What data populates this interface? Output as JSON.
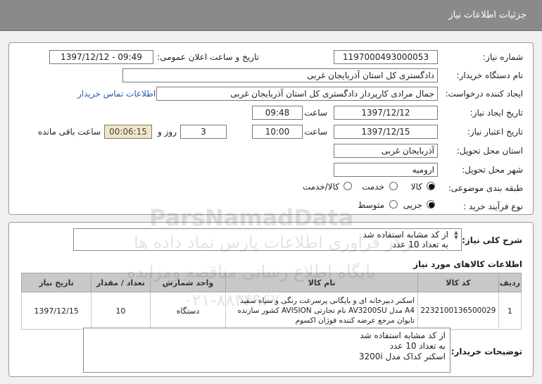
{
  "header": {
    "title": "جزئیات اطلاعات نیاز"
  },
  "form": {
    "need_number_label": "شماره نیاز:",
    "need_number": "1197000493000053",
    "announce_label": "تاریخ و ساعت اعلان عمومی:",
    "announce_value": "1397/12/12 - 09:49",
    "buyer_org_label": "نام دستگاه خریدار:",
    "buyer_org": "دادگستری کل استان آذربایجان غربی",
    "requester_label": "ایجاد کننده درخواست:",
    "requester": "جمال مرادی کارپرداز دادگستری کل استان آذربایجان غربی",
    "contact_link": "اطلاعات تماس خریدار",
    "create_date_label": "تاریخ ایجاد نیاز:",
    "create_date": "1397/12/12",
    "time_label": "ساعت",
    "create_time": "09:48",
    "valid_date_label": "تاریخ اعتبار نیاز:",
    "valid_date": "1397/12/15",
    "valid_time": "10:00",
    "days": "3",
    "days_label": "روز و",
    "remaining": "00:06:15",
    "remaining_label": "ساعت باقی مانده",
    "province_label": "استان محل تحویل:",
    "province": "آذربایجان غربی",
    "city_label": "شهر محل تحویل:",
    "city": "ارومیه",
    "category_label": "طبقه بندی موضوعی:",
    "category_options": [
      "کالا",
      "خدمت",
      "کالا/خدمت"
    ],
    "category_selected": 0,
    "process_label": "نوع فرآیند خرید :",
    "process_options": [
      "جزیی",
      "متوسط"
    ],
    "process_selected": 0
  },
  "summary": {
    "label": "شرح کلی نیاز:",
    "line1": "از کد مشابه استفاده شد",
    "line2": "به تعداد 10 عدد"
  },
  "goods": {
    "title": "اطلاعات کالاهای مورد نیاز",
    "columns": [
      "ردیف",
      "کد کالا",
      "نام کالا",
      "واحد شمارش",
      "تعداد / مقدار",
      "تاریخ نیاز"
    ],
    "rows": [
      {
        "row": "1",
        "code": "2232100136500029",
        "name": "اسکنر دبیرخانه ای و بایگانی پرسرعت رنگی و سیاه سفید A4 مدل AV3200SU نام تجارتی AVISION کشور سازنده تایوان مرجع عرضه کننده فوژان اکسوم",
        "unit": "دستگاه",
        "qty": "10",
        "date": "1397/12/15"
      }
    ]
  },
  "buyer_notes": {
    "label": "توضیحات خریدار:",
    "line1": "از کد مشابه استفاده شد",
    "line2": "به تعداد 10 عدد",
    "line3": "اسکنر کداک مدل 3200i"
  },
  "watermark": {
    "brand": "ParsNamadData",
    "line1": "مرکز فراوری اطلاعات پارس نماد داده ها",
    "line2": "پایگاه اطلاع رسانی مناقصه ومزایده",
    "phone": "۰۲۱-۸۸۳۴۹۶۷۰"
  }
}
